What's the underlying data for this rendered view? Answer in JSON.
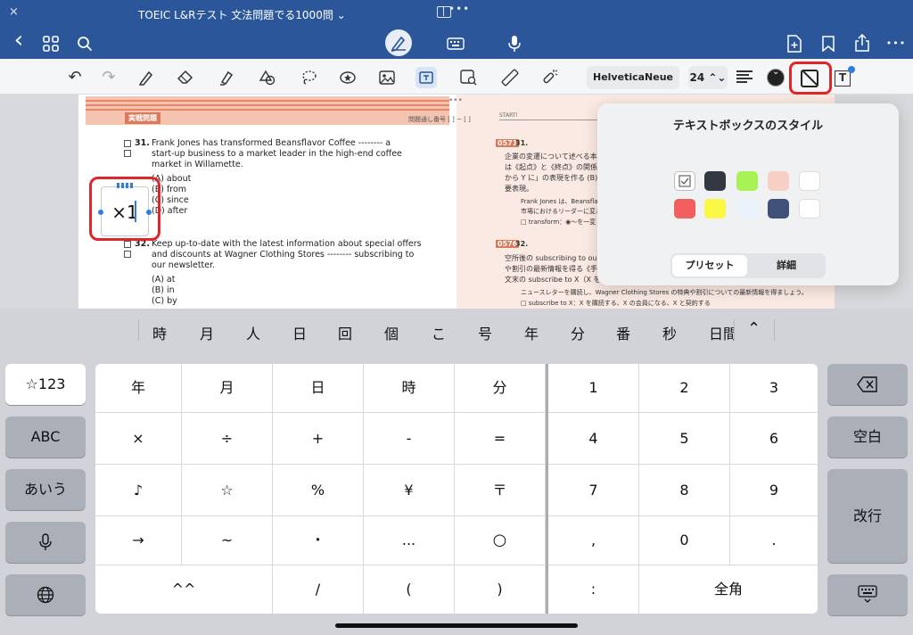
{
  "titlebar": {
    "title": "TOEIC L&Rテスト 文法問題でる1000問 ⌄",
    "close": "×",
    "dots": "•••"
  },
  "navbar": {
    "back": "‹",
    "grid": "⊞",
    "search": "⌕",
    "keyboard": "⌨",
    "mic": "🎙",
    "addpage": "⊕",
    "bookmark": "⌂",
    "share": "⇪",
    "more": "•••"
  },
  "toolbar": {
    "undo": "↶",
    "redo": "↷",
    "font": "HelveticaNeue",
    "size": "24 ⌃⌄"
  },
  "document": {
    "left": {
      "section": "実戦問題",
      "qnum": "問題通し番号 [ ] ~ [ ]",
      "q31": {
        "num": "31.",
        "lines": [
          "Frank Jones has transformed Beansflavor Coffee -------- a",
          "start-up business to a market leader in the high-end coffee",
          "market in Willamette."
        ],
        "options": [
          "(A) about",
          "(B) from",
          "(C) since",
          "(D) after"
        ]
      },
      "q32": {
        "num": "32.",
        "lines": [
          "Keep up-to-date with the latest information about special offers",
          "and discounts at Wagner Clothing Stores -------- subscribing to",
          "our newsletter."
        ],
        "options": [
          "(A) at",
          "(B) in",
          "(C) by"
        ]
      }
    },
    "right": {
      "header": "START!",
      "q31badge": "0571",
      "q31num": "31.",
      "q31lines": [
        "企業の変遷について述べる本",
        "は《起点》と《終点》の関係に",
        "から Y に」の表現を作る (B)",
        "要表現。"
      ],
      "q31notes": [
        "Frank Jones は、Beansflav",
        "市場におけるリーダーに変ル"
      ],
      "q31transform": "□ transform：◉～を一変",
      "q32badge": "0576",
      "q32num": "32.",
      "q32lines": [
        "空所後の subscribing to ou",
        "や割引の最新情報を得る《手",
        "文末の subscribe to X（X を"
      ],
      "q32note": "ニュースレターを購読し、Wagner Clothing Stores の特典や割引についての最新情報を得ましょう。",
      "q32sub": "□ subscribe to X：X を購読する、X の会員になる、X と契約する"
    }
  },
  "textbox": {
    "value": "×1"
  },
  "popover": {
    "title": "テキストボックスのスタイル",
    "swatches": [
      "#ffffff",
      "#343841",
      "#a8f255",
      "#f8cfc4",
      "#ffffff",
      "#f25f5f",
      "#fbf745",
      "#e9f2fb",
      "#40527a",
      "#ffffff"
    ],
    "preset": "プリセット",
    "detail": "詳細"
  },
  "candidates": [
    "時",
    "月",
    "人",
    "日",
    "回",
    "個",
    "こ",
    "号",
    "年",
    "分",
    "番",
    "秒",
    "日間"
  ],
  "candidates_more": "⌃",
  "keyboard": {
    "left": [
      "☆123",
      "ABC",
      "あいう"
    ],
    "right": [
      "⌫",
      "空白",
      "改行"
    ],
    "grid_left": [
      [
        "年",
        "月",
        "日",
        "時",
        "分"
      ],
      [
        "×",
        "÷",
        "+",
        "-",
        "="
      ],
      [
        "♪",
        "☆",
        "%",
        "¥",
        "〒"
      ],
      [
        "→",
        "~",
        "・",
        "...",
        "○"
      ],
      [
        "^^",
        "",
        "/",
        "(",
        ")"
      ]
    ],
    "grid_right": [
      [
        "1",
        "2",
        "3"
      ],
      [
        "4",
        "5",
        "6"
      ],
      [
        "7",
        "8",
        "9"
      ],
      [
        ",",
        "0",
        "."
      ],
      [
        ":",
        "全角",
        ""
      ]
    ]
  }
}
